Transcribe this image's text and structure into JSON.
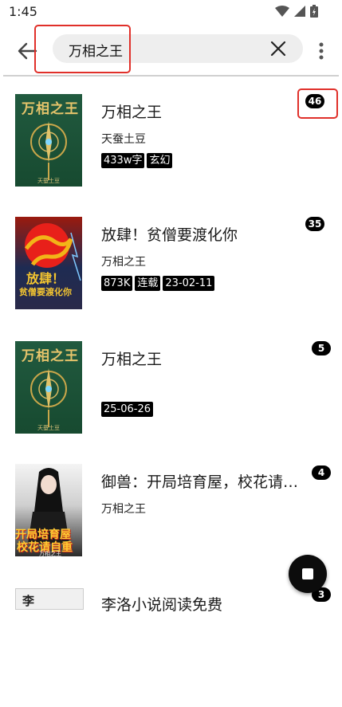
{
  "status_bar": {
    "time": "1:45"
  },
  "search": {
    "query": "万相之王"
  },
  "results": [
    {
      "title": "万相之王",
      "author": "天蚕土豆",
      "tags": [
        "433w字",
        "玄幻"
      ],
      "count": "46",
      "cover_title": "万相之王",
      "cover_author": "天蚕土豆"
    },
    {
      "title": "放肆！贫僧要渡化你",
      "author": "万相之王",
      "tags": [
        "873K",
        "连载",
        "23-02-11"
      ],
      "count": "35",
      "cover_title_line1": "放肆！",
      "cover_title_line2": "贫僧要渡化你"
    },
    {
      "title": "万相之王",
      "author": "",
      "tags": [
        "25-06-26"
      ],
      "count": "5",
      "cover_title": "万相之王",
      "cover_author": "天蚕土豆"
    },
    {
      "title": "御兽：开局培育屋，校花请自…",
      "author": "万相之王",
      "tags": [],
      "count": "4",
      "cover_title_line1": "开局培育屋",
      "cover_title_line2": "校花请自重",
      "cover_author": "万相之王"
    },
    {
      "title": "李洛小说阅读免费",
      "author": "",
      "tags": [],
      "count": "3",
      "cover_char": "李"
    }
  ],
  "colors": {
    "highlight": "#e0302a",
    "badge": "#000000",
    "tag": "#000000"
  }
}
